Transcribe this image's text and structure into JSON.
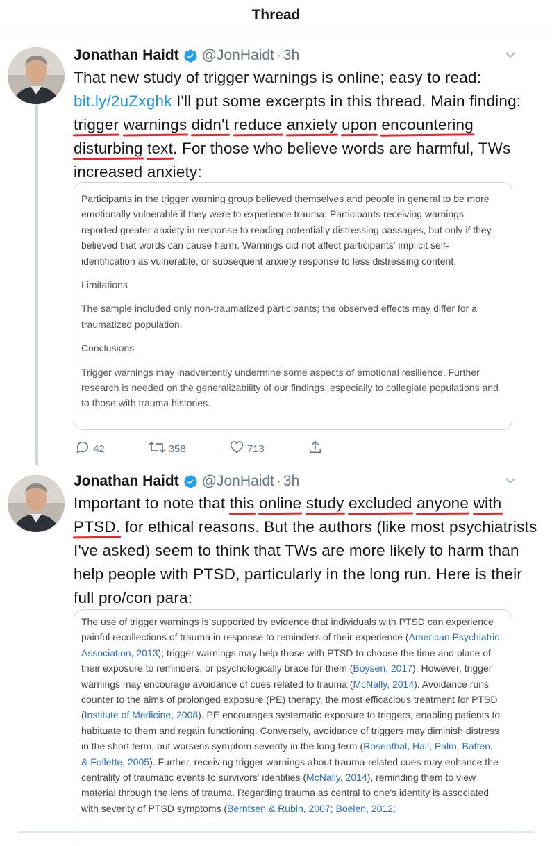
{
  "header": {
    "title": "Thread"
  },
  "tweets": [
    {
      "name": "Jonathan Haidt",
      "handle": "@JonHaidt",
      "dot": "·",
      "time": "3h",
      "text": {
        "p1": "That new study of trigger warnings is online; easy to read: ",
        "link": "bit.ly/2uZxghk",
        "p2": " I'll put some excerpts in this thread. Main finding: ",
        "u1": "trigger",
        "u2": "warnings",
        "u3": "didn't",
        "u4": "reduce",
        "u5": "anxiety",
        "u6": "upon",
        "u7": "encountering",
        "u8": "disturbing",
        "u9": "text",
        "p3": ". For those who believe words are harmful, TWs increased anxiety:"
      },
      "card": {
        "para1": "Participants in the trigger warning group believed themselves and people in general to be more emotionally vulnerable if they were to experience trauma. Participants receiving warnings reported greater anxiety in response to reading potentially distressing passages, but only if they believed that words can cause harm. Warnings did not affect participants' implicit self-identification as vulnerable, or subsequent anxiety response to less distressing content.",
        "h2": "Limitations",
        "para2": "The sample included only non-traumatized participants; the observed effects may differ for a traumatized population.",
        "h3": "Conclusions",
        "para3": "Trigger warnings may inadvertently undermine some aspects of emotional resilience. Further research is needed on the generalizability of our findings, especially to collegiate populations and to those with trauma histories."
      },
      "actions": {
        "replies": "42",
        "retweets": "358",
        "likes": "713"
      }
    },
    {
      "name": "Jonathan Haidt",
      "handle": "@JonHaidt",
      "dot": "·",
      "time": "3h",
      "text": {
        "p1": "Important to note that ",
        "u1": "this",
        "u2": "online",
        "u3": "study",
        "u4": "excluded",
        "u5": "anyone",
        "u6": "with",
        "u7": "PTSD.",
        "p2": " for ethical reasons. But the authors (like most psychiatrists I've asked) seem to think that TWs are more likely to harm than help people with PTSD, particularly in the long run. Here is their full pro/con para:"
      },
      "card": {
        "t1": "The use of trigger warnings is supported by evidence that individuals with PTSD can experience painful recollections of trauma in response to reminders of their experience (",
        "r1": "American Psychiatric Association, 2013",
        "t2": "); trigger warnings may help those with PTSD to choose the time and place of their exposure to reminders, or psychologically brace for them (",
        "r2": "Boysen, 2017",
        "t3": "). However, trigger warnings may encourage avoidance of cues related to trauma (",
        "r3": "McNally, 2014",
        "t4": "). Avoidance runs counter to the aims of prolonged exposure (PE) therapy, the most efficacious treatment for PTSD (",
        "r4": "Institute of Medicine, 2008",
        "t5": "). PE encourages systematic exposure to triggers, enabling patients to habituate to them and regain functioning. Conversely, avoidance of triggers may diminish distress in the short term, but worsens symptom severity in the long term (",
        "r5": "Rosenthal, Hall, Palm, Batten, & Follette, 2005",
        "t6": "). Further, receiving trigger warnings about trauma-related cues may enhance the centrality of traumatic events to survivors' identities (",
        "r6": "McNally, 2014",
        "t7": "), reminding them to view material through the lens of trauma. Regarding trauma as central to one's identity is associated with severity of PTSD symptoms (",
        "r7": "Berntsen & Rubin, 2007; Boelen, 2012;"
      }
    }
  ],
  "colors": {
    "link": "#1b95e0",
    "underline": "#e8242c",
    "verified": "#1da1f2",
    "muted": "#657786"
  },
  "icons": [
    "verified-icon",
    "chevron-down-icon",
    "reply-icon",
    "retweet-icon",
    "like-icon",
    "share-icon"
  ]
}
